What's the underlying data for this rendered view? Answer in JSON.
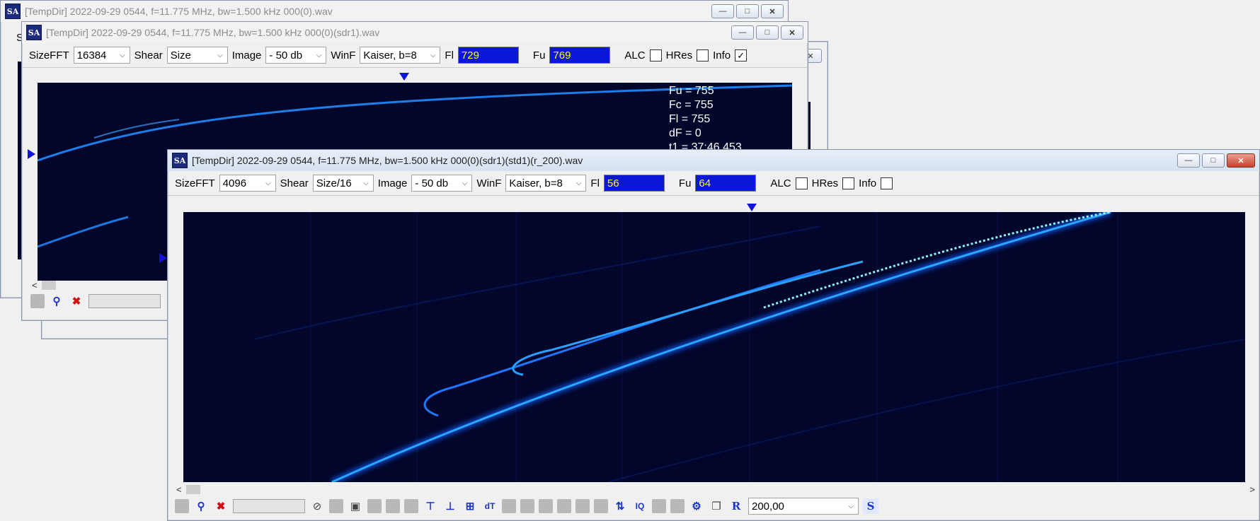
{
  "app_icon_text": "SA",
  "window_back": {
    "title": "[TempDir] 2022-09-29 0544, f=11.775 MHz, bw=1.500 kHz 000(0).wav",
    "fragment": "S"
  },
  "window_mid": {
    "title": "[TempDir] 2022-09-29 0544, f=11.775 MHz, bw=1.500 kHz 000(0)(sdr1).wav",
    "toolbar": {
      "sizefft_label": "SizeFFT",
      "sizefft_value": "16384",
      "shear_label": "Shear",
      "shear_value": "Size",
      "image_label": "Image",
      "image_value": "- 50 db",
      "winf_label": "WinF",
      "winf_value": "Kaiser, b=8",
      "fl_label": "Fl",
      "fl_value": "729",
      "fu_label": "Fu",
      "fu_value": "769",
      "alc_label": "ALC",
      "hres_label": "HRes",
      "info_label": "Info",
      "alc_checked": false,
      "hres_checked": false,
      "info_checked": true
    },
    "info": {
      "fu": "Fu = 755",
      "fc": "Fc = 755",
      "fl": "Fl = 755",
      "df": "dF = 0",
      "t1": "t1 = 37:46.453"
    }
  },
  "window_front": {
    "title": "[TempDir] 2022-09-29 0544, f=11.775 MHz, bw=1.500 kHz 000(0)(sdr1)(std1)(r_200).wav",
    "toolbar": {
      "sizefft_label": "SizeFFT",
      "sizefft_value": "4096",
      "shear_label": "Shear",
      "shear_value": "Size/16",
      "image_label": "Image",
      "image_value": "- 50 db",
      "winf_label": "WinF",
      "winf_value": "Kaiser, b=8",
      "fl_label": "Fl",
      "fl_value": "56",
      "fu_label": "Fu",
      "fu_value": "64",
      "alc_label": "ALC",
      "hres_label": "HRes",
      "info_label": "Info",
      "alc_checked": false,
      "hres_checked": false,
      "info_checked": false
    },
    "bottom": {
      "rate_value": "200,00",
      "r_label": "R",
      "s_label": "S",
      "dt_label": "dT",
      "iq_label": "IQ"
    }
  },
  "colors": {
    "spectrogram_bg": "#03062b",
    "signal": "#1e8cff",
    "field_bg": "#0a16d8",
    "field_text": "#ffff00"
  }
}
